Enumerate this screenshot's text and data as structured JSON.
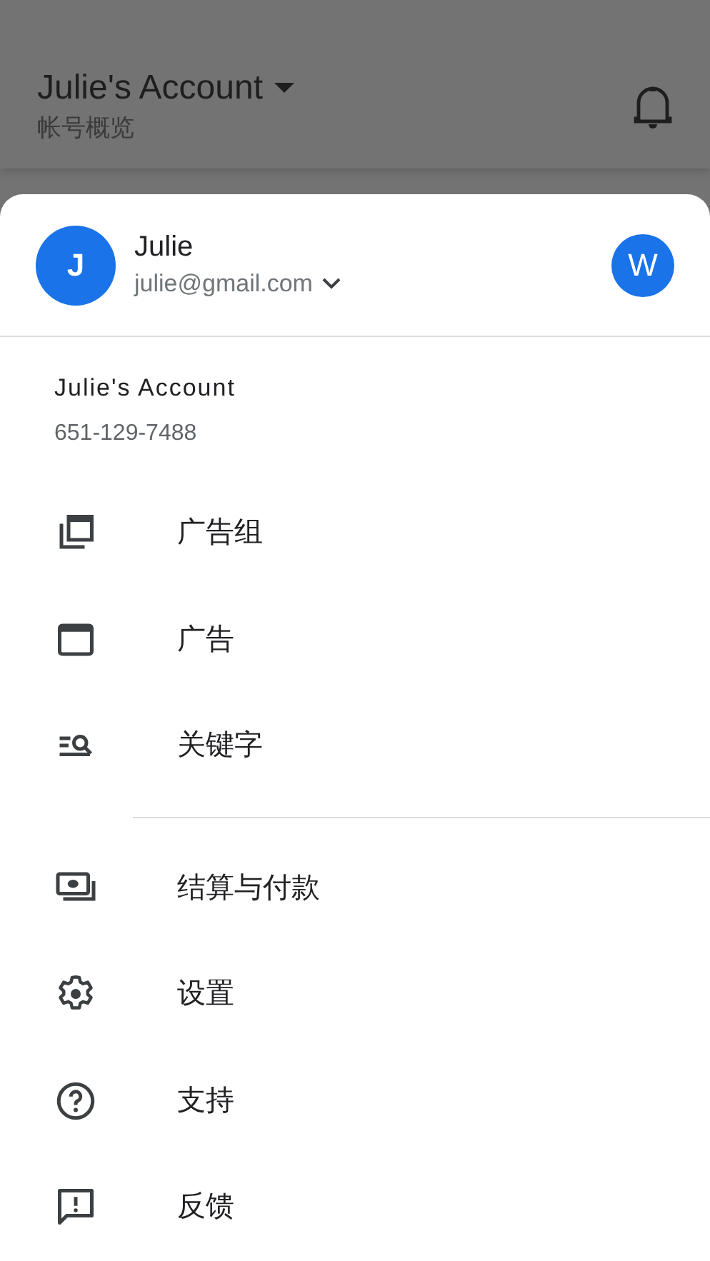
{
  "app_bar": {
    "title": "Julie's Account",
    "subtitle": "帐号概览"
  },
  "account_header": {
    "avatar_letter": "J",
    "name": "Julie",
    "email": "julie@gmail.com",
    "app_avatar_letter": "W"
  },
  "account": {
    "name": "Julie's Account",
    "id": "651-129-7488"
  },
  "menu_groups": [
    {
      "items": [
        {
          "kind": "ad-groups",
          "label": "广告组"
        },
        {
          "kind": "ads",
          "label": "广告"
        },
        {
          "kind": "keywords",
          "label": "关键字"
        }
      ]
    },
    {
      "items": [
        {
          "kind": "billing",
          "label": "结算与付款"
        },
        {
          "kind": "settings",
          "label": "设置"
        },
        {
          "kind": "support",
          "label": "支持"
        },
        {
          "kind": "feedback",
          "label": "反馈"
        }
      ]
    }
  ]
}
